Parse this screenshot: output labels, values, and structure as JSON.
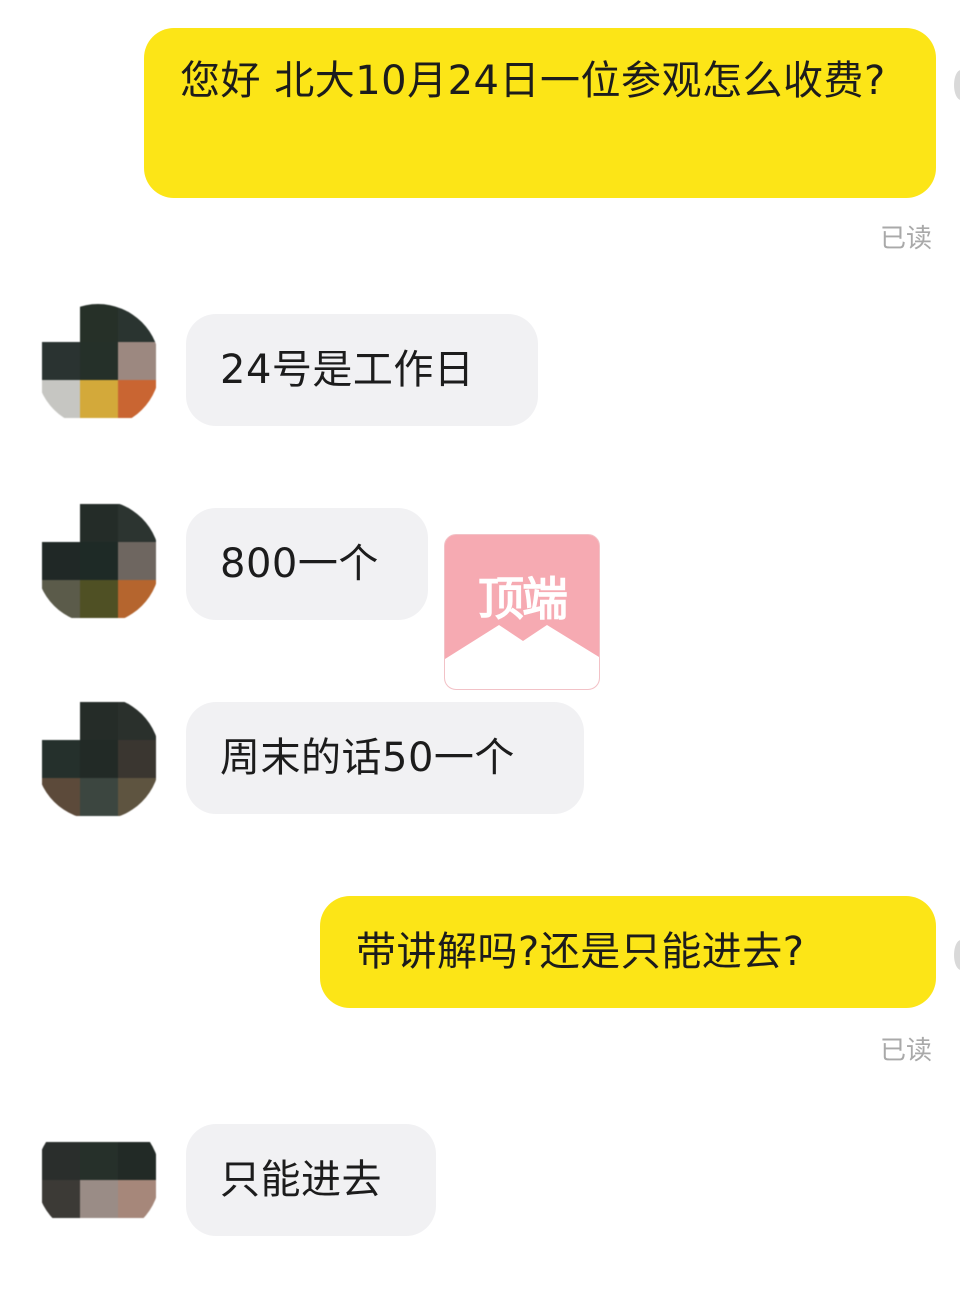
{
  "conversation": {
    "messages": [
      {
        "direction": "outgoing",
        "text": "您好 北大10月24日一位参观怎么收费?",
        "status": "已读"
      },
      {
        "direction": "incoming",
        "text": "24号是工作日"
      },
      {
        "direction": "incoming",
        "text": "800一个"
      },
      {
        "direction": "incoming",
        "text": "周末的话50一个"
      },
      {
        "direction": "outgoing",
        "text": "带讲解吗?还是只能进去?",
        "status": "已读"
      },
      {
        "direction": "incoming",
        "text": "只能进去"
      }
    ]
  },
  "watermark": {
    "text": "顶端",
    "icon": "envelope-icon",
    "color": "#f6aab2"
  },
  "colors": {
    "outgoing_bubble": "#fce517",
    "incoming_bubble": "#f1f1f3",
    "read_receipt": "#a9a9a9"
  },
  "avatars": [
    {
      "icon": "pixelated-avatar-icon"
    },
    {
      "icon": "pixelated-avatar-icon"
    },
    {
      "icon": "pixelated-avatar-icon"
    },
    {
      "icon": "pixelated-avatar-icon"
    }
  ]
}
